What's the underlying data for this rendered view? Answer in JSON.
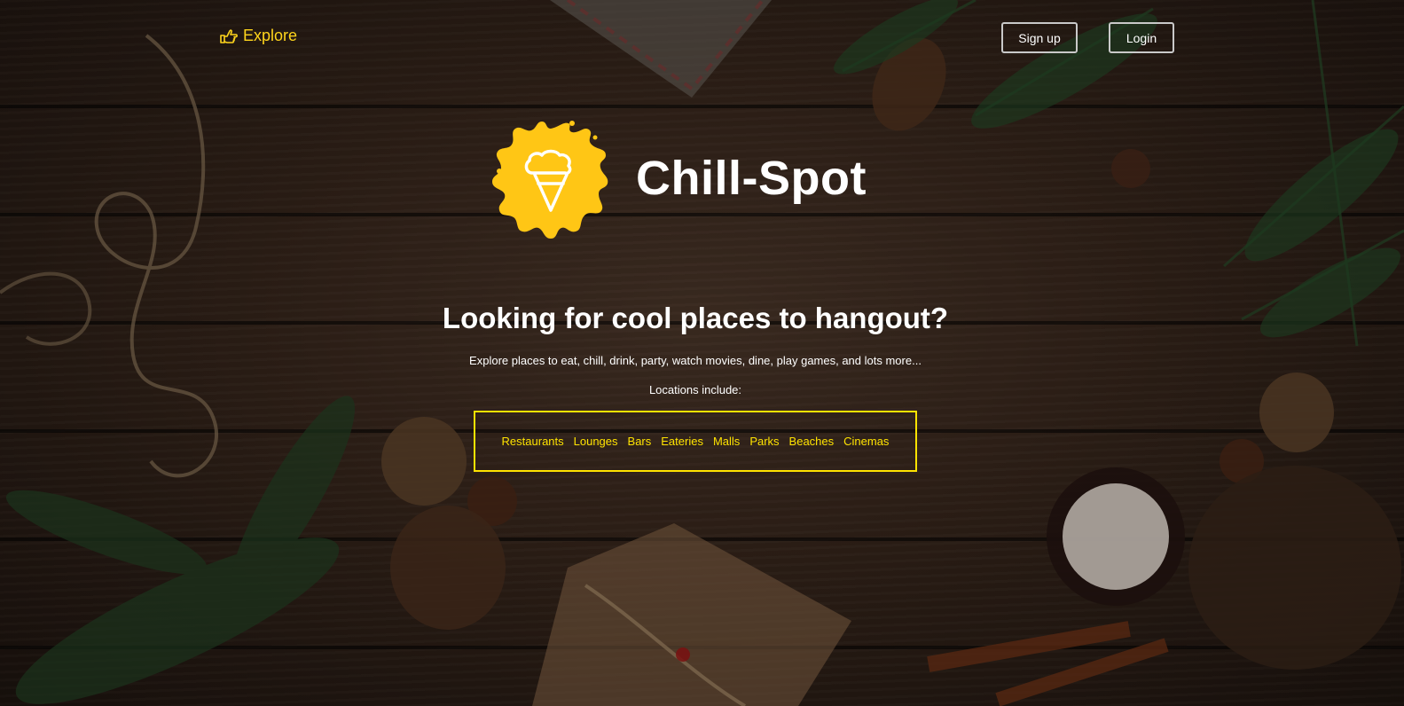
{
  "nav": {
    "brand_icon": "hand-point-right-icon",
    "brand_label": "Explore",
    "signup_label": "Sign up",
    "login_label": "Login"
  },
  "logo": {
    "icon": "ice-cream-icon",
    "title": "Chill-Spot"
  },
  "hero": {
    "headline": "Looking for cool places to hangout?",
    "description": "Explore places to eat, chill, drink, party, watch movies, dine, play games, and lots more...",
    "locations_label": "Locations include:",
    "locations": [
      "Restaurants",
      "Lounges",
      "Bars",
      "Eateries",
      "Malls",
      "Parks",
      "Beaches",
      "Cinemas"
    ]
  },
  "colors": {
    "accent": "#ffd51c",
    "box_border": "#ffe300",
    "text": "#ffffff",
    "background": "#2a1d15"
  }
}
